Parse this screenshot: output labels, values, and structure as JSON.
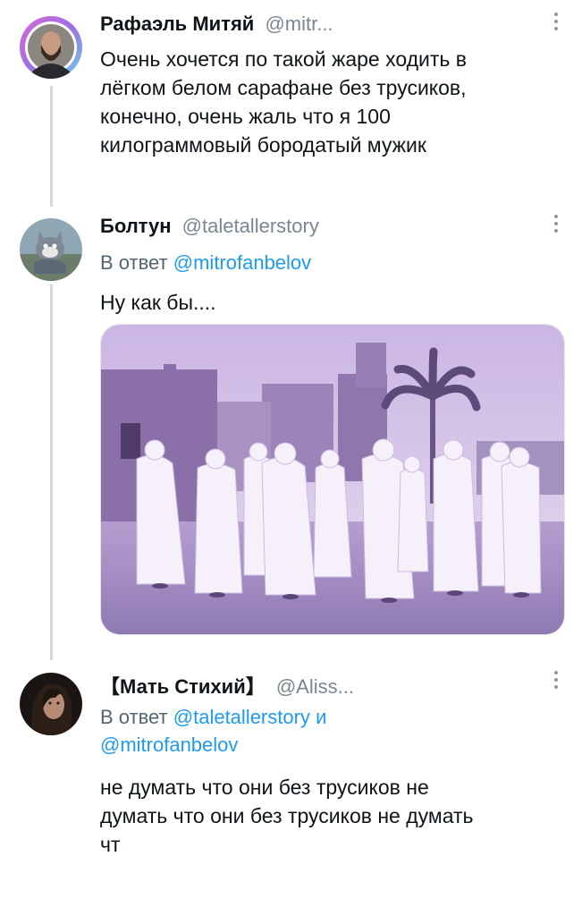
{
  "tweets": [
    {
      "author_name": "Рафаэль Митяй",
      "author_handle": "@mitr...",
      "text_lines": [
        "Очень хочется по такой жаре ходить в",
        "лёгком белом сарафане без трусиков,",
        "конечно, очень жаль что я 100",
        "килограммовый бородатый мужик"
      ]
    },
    {
      "author_name": "Болтун",
      "author_handle": "@taletallerstory",
      "reply_prefix": "В ответ",
      "reply_to": "@mitrofanbelov",
      "text_lines": [
        "Ну как бы...."
      ],
      "media": {
        "icon": "photo-men-in-white-robes"
      }
    },
    {
      "author_name": "【Мать Стихий】",
      "author_handle": "@Aliss...",
      "reply_prefix": "В ответ",
      "reply_to_1": "@taletallerstory",
      "reply_joiner": "и",
      "reply_to_2": "@mitrofanbelov",
      "text_lines": [
        "не думать что они без трусиков не",
        "думать что они без трусиков не думать",
        "чт"
      ]
    }
  ],
  "colors": {
    "link": "#1d9bf0",
    "muted": "#7a8690",
    "thread_line": "#cfd9de",
    "media_tint": "#b6a6d6"
  },
  "icons": [
    "more-options-icon",
    "avatar-bearded-man",
    "avatar-cartoon-cat",
    "avatar-woman"
  ]
}
